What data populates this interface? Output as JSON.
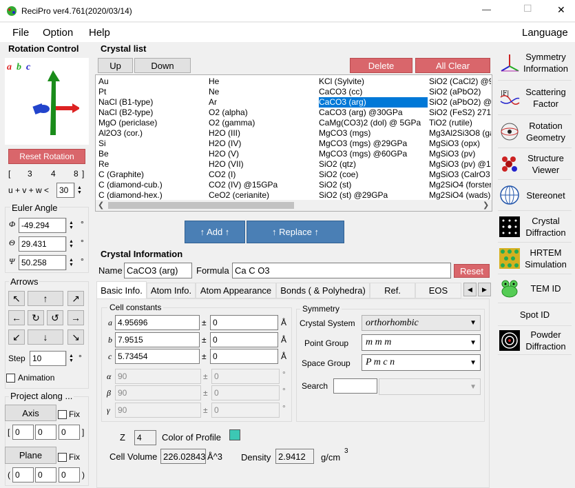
{
  "window": {
    "title": "ReciPro  ver4.761(2020/03/14)",
    "min": "—",
    "max": "☐",
    "close": "✕"
  },
  "menu": {
    "file": "File",
    "option": "Option",
    "help": "Help",
    "language": "Language"
  },
  "rotation": {
    "header": "Rotation Control",
    "abc": [
      "a",
      "b",
      "c"
    ],
    "reset": "Reset Rotation",
    "index": {
      "lb": "[",
      "h": "3",
      "k": "4",
      "l": "8",
      "rb": "]"
    },
    "uvw_label": "u + v + w <",
    "uvw_value": "30",
    "euler_header": "Euler Angle",
    "phi_sym": "Φ",
    "phi": "-49.294",
    "theta_sym": "Θ",
    "theta": "29.431",
    "psi_sym": "Ψ",
    "psi": "50.258",
    "deg": "°",
    "arrows_header": "Arrows",
    "arrow_glyphs": [
      "↖",
      "↑",
      "↗",
      "←",
      "↻",
      "↺",
      "→",
      "↙",
      "↓",
      "↘"
    ],
    "step_label": "Step",
    "step": "10",
    "animation": "Animation",
    "project_header": "Project along ...",
    "axis": "Axis",
    "fix": "Fix",
    "plane": "Plane",
    "axis_vals": [
      "0",
      "0",
      "0"
    ],
    "plane_vals": [
      "0",
      "0",
      "0"
    ],
    "lb": "[",
    "rb": "]",
    "lp": "(",
    "rp": ")"
  },
  "crystal_list": {
    "header": "Crystal list",
    "up": "Up",
    "down": "Down",
    "delete": "Delete",
    "all_clear": "All Clear",
    "columns": [
      [
        "Au",
        "Pt",
        "NaCl (B1-type)",
        "NaCl (B2-type)",
        "MgO (periclase)",
        "Al2O3 (cor.)",
        "Si",
        "Be",
        "Re",
        "C (Graphite)",
        "C (diamond-cub.)",
        "C (diamond-hex.)"
      ],
      [
        "He",
        "Ne",
        "Ar",
        "O2 (alpha)",
        "O2 (gamma)",
        "H2O (III)",
        "H2O (IV)",
        "H2O (V)",
        "H2O (VII)",
        "CO2 (I)",
        "CO2 (IV) @15GPa",
        "CeO2 (cerianite)"
      ],
      [
        "KCl (Sylvite)",
        "CaCO3 (cc)",
        "CaCO3 (arg)",
        "CaCO3 (arg) @30GPa",
        "CaMg(CO3)2 (dol) @ 5GPa",
        "MgCO3 (mgs)",
        "MgCO3 (mgs) @29GPa",
        "MgCO3 (mgs) @60GPa",
        "SiO2 (qtz)",
        "SiO2 (coe)",
        "SiO2 (st)",
        "SiO2 (st) @29GPa"
      ],
      [
        "SiO2 (CaCl2) @9",
        "SiO2 (aPbO2)",
        "SiO2 (aPbO2) @",
        "SiO2 (FeS2) 271",
        "TiO2 (rutile)",
        "Mg3Al2Si3O8 (ga",
        "MgSiO3 (opx)",
        "MgSiO3 (pv)",
        "MgSiO3 (pv) @15",
        "MgSiO3 (CalrO3",
        "Mg2SiO4 (forster",
        "Mg2SiO4 (wads)"
      ]
    ],
    "selected": "CaCO3 (arg)",
    "add": "↑ Add ↑",
    "replace": "↑ Replace ↑"
  },
  "info": {
    "header": "Crystal Information",
    "name_label": "Name",
    "name": "CaCO3 (arg)",
    "formula_label": "Formula",
    "formula": "Ca C O3",
    "reset": "Reset",
    "tabs": [
      "Basic Info.",
      "Atom Info.",
      "Atom Appearance",
      "Bonds ( & Polyhedra)",
      "Ref.",
      "EOS"
    ],
    "cell_header": "Cell constants",
    "a_sym": "a",
    "a": "4.95696",
    "a_err": "0",
    "b_sym": "b",
    "b": "7.9515",
    "b_err": "0",
    "c_sym": "c",
    "c": "5.73454",
    "c_err": "0",
    "alpha_sym": "α",
    "alpha": "90",
    "alpha_err": "0",
    "beta_sym": "β",
    "beta": "90",
    "beta_err": "0",
    "gamma_sym": "γ",
    "gamma": "90",
    "gamma_err": "0",
    "pm": "±",
    "ang": "Å",
    "deg": "°",
    "sym_header": "Symmetry",
    "crystal_system_label": "Crystal System",
    "crystal_system": "orthorhombic",
    "point_group_label": "Point Group",
    "point_group": "m m m",
    "space_group_label": "Space Group",
    "space_group": "P m c n",
    "search_label": "Search",
    "z_label": "Z",
    "z": "4",
    "color_label": "Color of Profile",
    "volume_label": "Cell Volume",
    "volume": "226.02843",
    "volume_unit": "Å^3",
    "density_label": "Density",
    "density": "2.9412",
    "density_unit": "g/cm",
    "density_exp": "3",
    "dropdown": "⌄"
  },
  "sidebar": [
    "Symmetry Information",
    "Scattering Factor",
    "Rotation Geometry",
    "Structure Viewer",
    "Stereonet",
    "Crystal Diffraction",
    "HRTEM Simulation",
    "TEM ID",
    "Spot ID",
    "Powder Diffraction"
  ],
  "icons": {
    "f_label": "|F|"
  },
  "colors": {
    "accent_red": "#d9666b",
    "accent_blue": "#4a7fb5",
    "selection": "#0078d7",
    "profile": "#3cc8b4"
  }
}
